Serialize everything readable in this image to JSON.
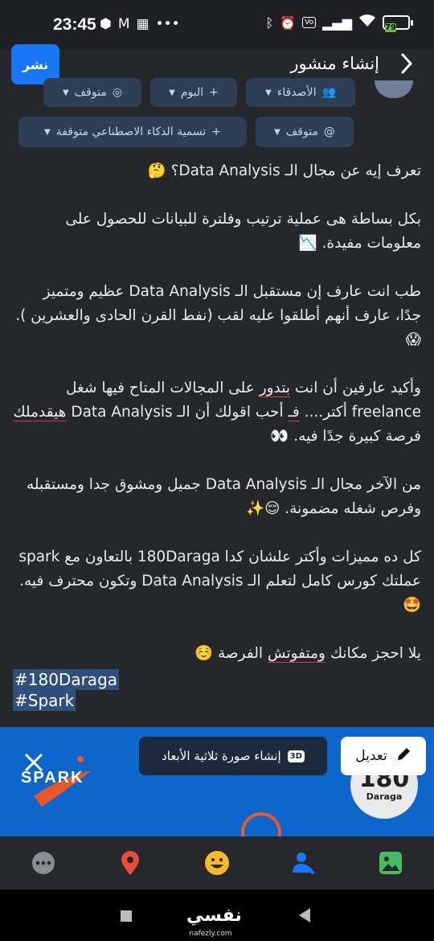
{
  "status_bar": {
    "time": "23:45",
    "left_icons": [
      "box-icon",
      "gmail-icon",
      "calendar-icon",
      "more-dots-icon"
    ],
    "right_icons": [
      "bluetooth-icon",
      "alarm-icon",
      "volte-icon",
      "signal-icon",
      "wifi-icon"
    ],
    "volte_label": "Vo\nLTE",
    "battery_level": "79"
  },
  "header": {
    "title": "إنشاء منشور",
    "post_button": "نشر"
  },
  "chips": {
    "friends": "الأصدقاء",
    "album": "البوم",
    "instagram_off": "متوقف",
    "threads_off": "متوقف",
    "ai_label": "تسمية الذكاء الاصطناعي متوقفة"
  },
  "post": {
    "p1": "تعرف إيه عن مجال الـ Data Analysis؟ 🤔",
    "p2": "بكل بساطة هى عملية ترتيب وفلترة للبيانات للحصول على معلومات مفيدة. 📉",
    "p3": "طب انت عارف إن مستقبل الـ Data Analysis عظيم ومتميز جدًا، عارف أنهم أطلقوا عليه لقب (نفط القرن الحادى والعشرين ). 😱",
    "p4_a": "وأكيد عارفين أن انت ",
    "p4_b": "بتدور",
    "p4_c": " على المجالات المتاح فيها شغل freelance أكتر.... ",
    "p4_d": "فـ",
    "p4_e": " أحب اقولك أن الـ Data Analysis ",
    "p4_f": "هيقدملك",
    "p4_g": " فرصة كبيرة جدًا فيه. 👀",
    "p5": "من الآخر مجال الـ Data Analysis جميل ومشوق جدا ومستقبله وفرص شغله مضمونة. 😌✨",
    "p6": "كل ده مميزات وأكتر علشان كدا 180Daraga بالتعاون مع spark عملتك كورس كامل لتعلم الـ Data Analysis وتكون محترف فيه. 🤩",
    "p7_a": "يلا احجز مكانك ",
    "p7_b": "ومتفوتش",
    "p7_c": " الفرصة ☺️",
    "hashtag1": "#180Daraga",
    "hashtag2": "#Spark"
  },
  "banner": {
    "spark_logo_text": "SPARK",
    "daraga_seal_number": "180",
    "daraga_seal_word": "Daraga",
    "create_3d_label": "إنشاء صورة ثلاثية الأبعاد",
    "badge_3d": "3D",
    "edit_label": "تعديل"
  },
  "toolbar": {
    "icons": [
      "more-icon",
      "location-icon",
      "emoji-icon",
      "tag-people-icon",
      "photo-icon"
    ],
    "colors": {
      "more": "#8a8d91",
      "location": "#e94e3c",
      "emoji": "#f7b928",
      "tag": "#1877f2",
      "photo": "#45bd62"
    }
  },
  "watermark": {
    "arabic": "نفسي",
    "latin": "nafezly.com"
  }
}
